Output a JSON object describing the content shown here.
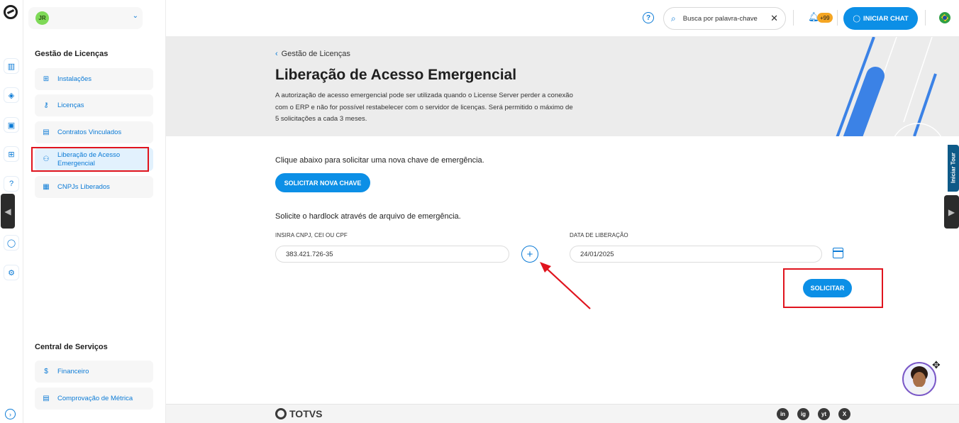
{
  "user": {
    "initials": "JR"
  },
  "header": {
    "search_placeholder": "Busca por palavra-chave",
    "notifications_count": "+99",
    "chat_label": "INICIAR CHAT"
  },
  "sidebar": {
    "section1_title": "Gestão de Licenças",
    "items": [
      {
        "label": "Instalações"
      },
      {
        "label": "Licenças"
      },
      {
        "label": "Contratos Vinculados"
      },
      {
        "label": "Liberação de Acesso Emergencial"
      },
      {
        "label": "CNPJs Liberados"
      }
    ],
    "section2_title": "Central de Serviços",
    "items2": [
      {
        "label": "Financeiro"
      },
      {
        "label": "Comprovação de Métrica"
      }
    ]
  },
  "banner": {
    "breadcrumb": "Gestão de Licenças",
    "title": "Liberação de Acesso Emergencial",
    "description": "A autorização de acesso emergencial pode ser utilizada quando o License Server perder a conexão com o ERP e não for possível restabelecer com o servidor de licenças. Será permitido o máximo de 5 solicitações a cada 3 meses."
  },
  "main": {
    "new_key_text": "Clique abaixo para solicitar uma nova chave de emergência.",
    "new_key_button": "SOLICITAR NOVA CHAVE",
    "hardlock_text": "Solicite o hardlock através de arquivo de emergência.",
    "cnpj_label": "INSIRA CNPJ, CEI OU CPF",
    "cnpj_value": "383.421.726-35",
    "date_label": "DATA DE LIBERAÇÃO",
    "date_value": "24/01/2025",
    "submit_button": "SOLICITAR"
  },
  "tour_label": "Iniciar Tour",
  "footer": {
    "brand": "TOTVS",
    "social": [
      "in",
      "ig",
      "yt",
      "X"
    ]
  },
  "colors": {
    "accent": "#0c8fe6",
    "highlight": "#e0141e"
  }
}
